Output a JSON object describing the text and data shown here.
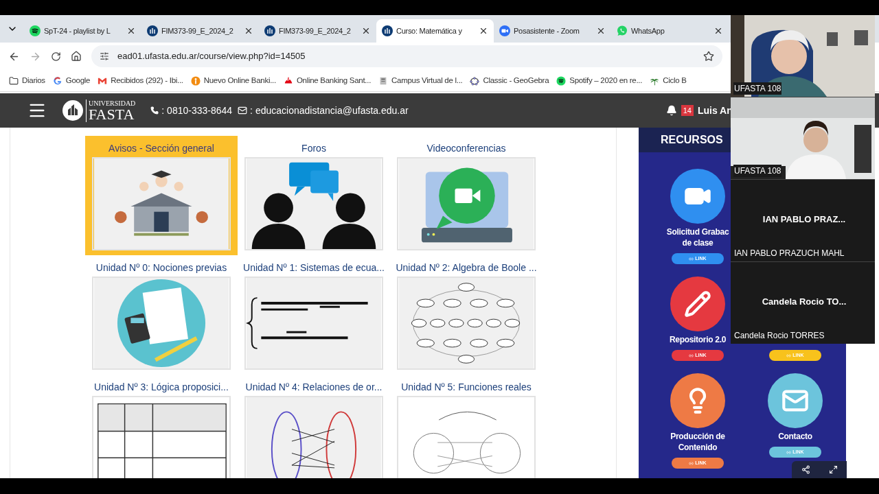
{
  "tabs": [
    {
      "title": "SpT-24 - playlist by L",
      "selected": false
    },
    {
      "title": "FIM373-99_E_2024_2",
      "selected": false
    },
    {
      "title": "FIM373-99_E_2024_2",
      "selected": false
    },
    {
      "title": "Curso: Matemática y",
      "selected": true
    },
    {
      "title": "Posasistente - Zoom",
      "selected": false
    },
    {
      "title": "WhatsApp",
      "selected": false
    }
  ],
  "address_bar": {
    "url": "ead01.ufasta.edu.ar/course/view.php?id=14505"
  },
  "bookmarks": [
    "Diarios",
    "Google",
    "Recibidos (292) - Ibi...",
    "Nuevo Online Banki...",
    "Online Banking Sant...",
    "Campus Virtual de l...",
    "Classic - GeoGebra",
    "Spotify – 2020 en re...",
    "Ciclo B"
  ],
  "site_header": {
    "logo": {
      "top": "UNIVERSIDAD",
      "bottom": "FASTA"
    },
    "phone": ": 0810-333-8644",
    "email": ": educacionadistancia@ufasta.edu.ar",
    "notifications": "14",
    "user": "Luis An"
  },
  "tiles": [
    {
      "label": "Avisos - Sección general",
      "highlighted": true
    },
    {
      "label": "Foros",
      "highlighted": false
    },
    {
      "label": "Videoconferencias",
      "highlighted": false
    },
    {
      "label": "Unidad Nº 0: Nociones previas",
      "highlighted": false
    },
    {
      "label": "Unidad Nº 1: Sistemas de ecua...",
      "highlighted": false
    },
    {
      "label": "Unidad Nº 2: Algebra de Boole ...",
      "highlighted": false
    },
    {
      "label": "Unidad Nº 3: Lógica proposici...",
      "highlighted": false
    },
    {
      "label": "Unidad Nº 4: Relaciones de or...",
      "highlighted": false
    },
    {
      "label": "Unidad Nº 5: Funciones reales",
      "highlighted": false
    }
  ],
  "resources": {
    "title": "RECURSOS",
    "rows": [
      {
        "cards": [
          {
            "title_lines": [
              "Solicitud Grabac",
              "de clase"
            ],
            "color": "#2f8ff0",
            "link": "LINK"
          }
        ]
      },
      {
        "cards": [
          {
            "title_lines": [
              "Repositorio 2.0"
            ],
            "color": "#e53940",
            "link": "LINK"
          },
          {
            "color": "#f8c21c",
            "link": "LINK"
          }
        ]
      },
      {
        "cards": [
          {
            "title_lines": [
              "Producción de",
              "Contenido"
            ],
            "color": "#ee7a45",
            "link": "LINK"
          },
          {
            "title_lines": [
              "Contacto"
            ],
            "color": "#6cc4dc",
            "link": "LINK"
          }
        ]
      }
    ]
  },
  "video_call": {
    "participants": [
      {
        "kind": "video",
        "label": "UFASTA 108"
      },
      {
        "kind": "video",
        "label": "UFASTA 108"
      },
      {
        "kind": "name",
        "display": "IAN PABLO PRAZ...",
        "label": "IAN PABLO PRAZUCH MAHL"
      },
      {
        "kind": "name",
        "display": "Candela Rocio TO...",
        "label": "Candela Rocio TORRES"
      }
    ]
  }
}
